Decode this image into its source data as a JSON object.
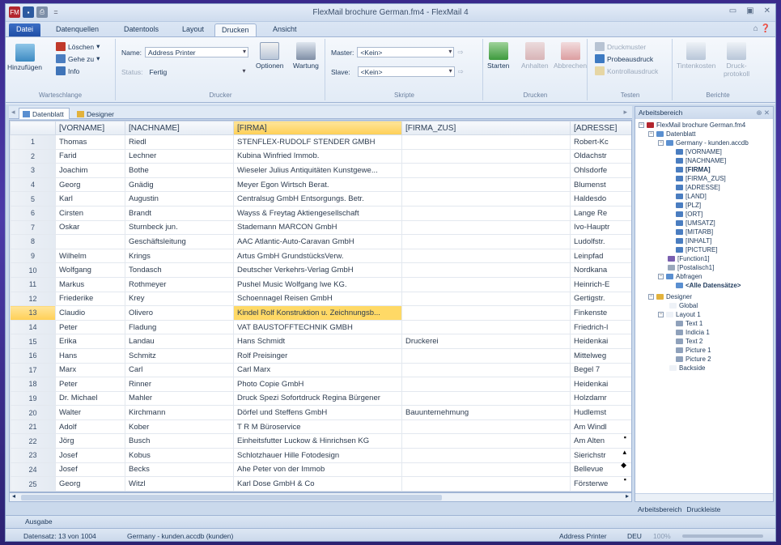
{
  "window": {
    "title": "FlexMail brochure German.fm4 - FlexMail 4"
  },
  "ribbon_tabs": [
    "Datei",
    "Datenquellen",
    "Datentools",
    "Layout",
    "Drucken",
    "Ansicht"
  ],
  "ribbon": {
    "warteschlange": {
      "label": "Warteschlange",
      "add": "Hinzufügen",
      "delete": "Löschen",
      "goto": "Gehe zu",
      "info": "Info"
    },
    "drucker": {
      "label": "Drucker",
      "name_label": "Name:",
      "name_value": "Address Printer",
      "status_label": "Status:",
      "status_value": "Fertig",
      "options": "Optionen",
      "maintenance": "Wartung"
    },
    "skripte": {
      "label": "Skripte",
      "master_label": "Master:",
      "master_value": "<Kein>",
      "slave_label": "Slave:",
      "slave_value": "<Kein>"
    },
    "drucken": {
      "label": "Drucken",
      "start": "Starten",
      "pause": "Anhalten",
      "cancel": "Abbrechen"
    },
    "testen": {
      "label": "Testen",
      "sample": "Druckmuster",
      "test_print": "Probeausdruck",
      "control_print": "Kontrollausdruck"
    },
    "berichte": {
      "label": "Berichte",
      "cost": "Tintenkosten",
      "log": "Druck-\nprotokoll"
    }
  },
  "doc_tabs": [
    "Datenblatt",
    "Designer"
  ],
  "grid": {
    "columns": [
      "[VORNAME]",
      "[NACHNAME]",
      "[FIRMA]",
      "[FIRMA_ZUS]",
      "[ADRESSE]"
    ],
    "rows": [
      [
        "1",
        "Thomas",
        "Riedl",
        "STENFLEX-RUDOLF STENDER GMBH",
        "",
        "Robert-Kc"
      ],
      [
        "2",
        "Farid",
        "Lechner",
        "Kubina Winfried Immob.",
        "",
        "Oldachstr"
      ],
      [
        "3",
        "Joachim",
        "Bothe",
        "Wieseler Julius Antiquitäten Kunstgewe...",
        "",
        "Ohlsdorfe"
      ],
      [
        "4",
        "Georg",
        "Gnädig",
        "Meyer Egon Wirtsch Berat.",
        "",
        "Blumenst"
      ],
      [
        "5",
        "Karl",
        "Augustin",
        "Centralsug GmbH Entsorgungs. Betr.",
        "",
        "Haldesdo"
      ],
      [
        "6",
        "Cirsten",
        "Brandt",
        "Wayss & Freytag Aktiengesellschaft",
        "",
        "Lange Re"
      ],
      [
        "7",
        "Oskar",
        "Sturnbeck jun.",
        "Stademann MARCON GmbH",
        "",
        "Ivo-Hauptr"
      ],
      [
        "8",
        "",
        "Geschäftsleitung",
        "AAC Atlantic-Auto-Caravan GmbH",
        "",
        "Ludolfstr."
      ],
      [
        "9",
        "Wilhelm",
        "Krings",
        "Artus GmbH GrundstücksVerw.",
        "",
        "Leinpfad"
      ],
      [
        "10",
        "Wolfgang",
        "Tondasch",
        "Deutscher Verkehrs-Verlag GmbH",
        "",
        "Nordkana"
      ],
      [
        "11",
        "Markus",
        "Rothmeyer",
        "Pushel Music Wolfgang Iwe KG.",
        "",
        "Heinrich-E"
      ],
      [
        "12",
        "Friederike",
        "Krey",
        "Schoennagel Reisen GmbH",
        "",
        "Gertigstr."
      ],
      [
        "13",
        "Claudio",
        "Olivero",
        "Kindel Rolf Konstruktion u. Zeichnungsb...",
        "",
        "Finkenste"
      ],
      [
        "14",
        "Peter",
        "Fladung",
        "VAT BAUSTOFFTECHNIK GMBH",
        "",
        "Friedrich-l"
      ],
      [
        "15",
        "Erika",
        "Landau",
        "Hans Schmidt",
        "Druckerei",
        "Heidenkai"
      ],
      [
        "16",
        "Hans",
        "Schmitz",
        "Rolf Preisinger",
        "",
        "Mittelweg"
      ],
      [
        "17",
        "Marx",
        "Carl",
        "Carl Marx",
        "",
        "Begel 7"
      ],
      [
        "18",
        "Peter",
        "Rinner",
        "Photo Copie GmbH",
        "",
        "Heidenkai"
      ],
      [
        "19",
        "Dr. Michael",
        "Mahler",
        "Druck Spezi Sofortdruck Regina Bürgener",
        "",
        "Holzdamr"
      ],
      [
        "20",
        "Walter",
        "Kirchmann",
        "Dörfel und Steffens GmbH",
        "Bauunternehmung",
        "Hudlemst"
      ],
      [
        "21",
        "Adolf",
        "Kober",
        "T R M Büroservice",
        "",
        "Am Windl"
      ],
      [
        "22",
        "Jörg",
        "Busch",
        "Einheitsfutter Luckow & Hinrichsen KG",
        "",
        "Am Alten"
      ],
      [
        "23",
        "Josef",
        "Kobus",
        "Schlotzhauer Hille Fotodesign",
        "",
        "Sierichstr"
      ],
      [
        "24",
        "Josef",
        "Becks",
        "Ahe Peter von der Immob",
        "",
        "Bellevue"
      ],
      [
        "25",
        "Georg",
        "Witzl",
        "Karl Dose GmbH & Co",
        "",
        "Försterwe"
      ]
    ],
    "current_row": "13",
    "selected_column": "[FIRMA]"
  },
  "pane": {
    "title": "Arbeitsbereich",
    "tree": {
      "root": "FlexMail brochure German.fm4",
      "datenblatt": "Datenblatt",
      "source": "Germany - kunden.accdb",
      "fields": [
        "[VORNAME]",
        "[NACHNAME]",
        "[FIRMA]",
        "[FIRMA_ZUS]",
        "[ADRESSE]",
        "[LAND]",
        "[PLZ]",
        "[ORT]",
        "[UMSATZ]",
        "[MITARB]",
        "[INHALT]",
        "[PICTURE]"
      ],
      "function": "[Function1]",
      "postal": "[Postalisch1]",
      "queries": "Abfragen",
      "all_records": "<Alle Datensätze>",
      "designer": "Designer",
      "global": "Global",
      "layout": "Layout 1",
      "layout_items": [
        "Text 1",
        "Indicia 1",
        "Text 2",
        "Picture 1",
        "Picture 2"
      ],
      "backside": "Backside"
    },
    "tabs": [
      "Arbeitsbereich",
      "Druckleiste"
    ]
  },
  "output_tab": "Ausgabe",
  "status": {
    "records": "Datensatz: 13 von 1004",
    "source": "Germany - kunden.accdb (kunden)",
    "printer": "Address Printer",
    "lang": "DEU",
    "zoom": "100%"
  },
  "colors": {
    "accent": "#1f4fa6",
    "selection": "#ffd966",
    "frame": "#3a2a8c"
  }
}
